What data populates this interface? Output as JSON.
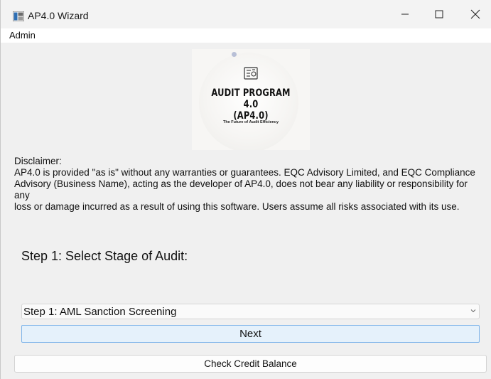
{
  "window": {
    "title": "AP4.0 Wizard",
    "controls": {
      "minimize": "minimize-icon",
      "maximize": "maximize-icon",
      "close": "close-icon"
    }
  },
  "menu": {
    "items": [
      {
        "label": "Admin"
      }
    ]
  },
  "logo": {
    "title_line1": "AUDIT PROGRAM 4.0",
    "title_line2": "(AP4.0)",
    "tagline": "The Future of Audit Efficiency",
    "icon": "document-scan-icon"
  },
  "disclaimer": {
    "heading": "Disclaimer:",
    "body": "AP4.0 is provided \"as is\" without any warranties or guarantees. EQC Advisory Limited, and EQC Compliance\nAdvisory (Business Name), acting as the developer of AP4.0, does not bear any liability or responsibility for any\nloss or damage incurred as a result of using this software. Users assume all risks associated with its use."
  },
  "step": {
    "heading": "Step 1: Select Stage of Audit:",
    "selected_stage": "Step 1: AML Sanction Screening"
  },
  "buttons": {
    "next": "Next",
    "check_credit": "Check Credit Balance"
  },
  "colors": {
    "window_bg": "#f0f0f0",
    "primary_button_bg": "#e5f1fb",
    "primary_button_border": "#7eb4ea"
  }
}
